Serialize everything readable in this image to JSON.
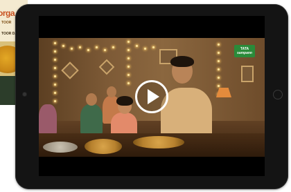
{
  "product": {
    "brand": "orga",
    "line1": "TOOR",
    "line2": "TOOR DA"
  },
  "video": {
    "logo_line1": "TATA",
    "logo_line2": "sampann"
  },
  "icons": {
    "play": "play-icon",
    "camera": "camera-dot",
    "home": "home-button"
  },
  "colors": {
    "tablet_bezel": "#141414",
    "logo_green": "#2a8b3a",
    "play_button": "#ffffff"
  }
}
